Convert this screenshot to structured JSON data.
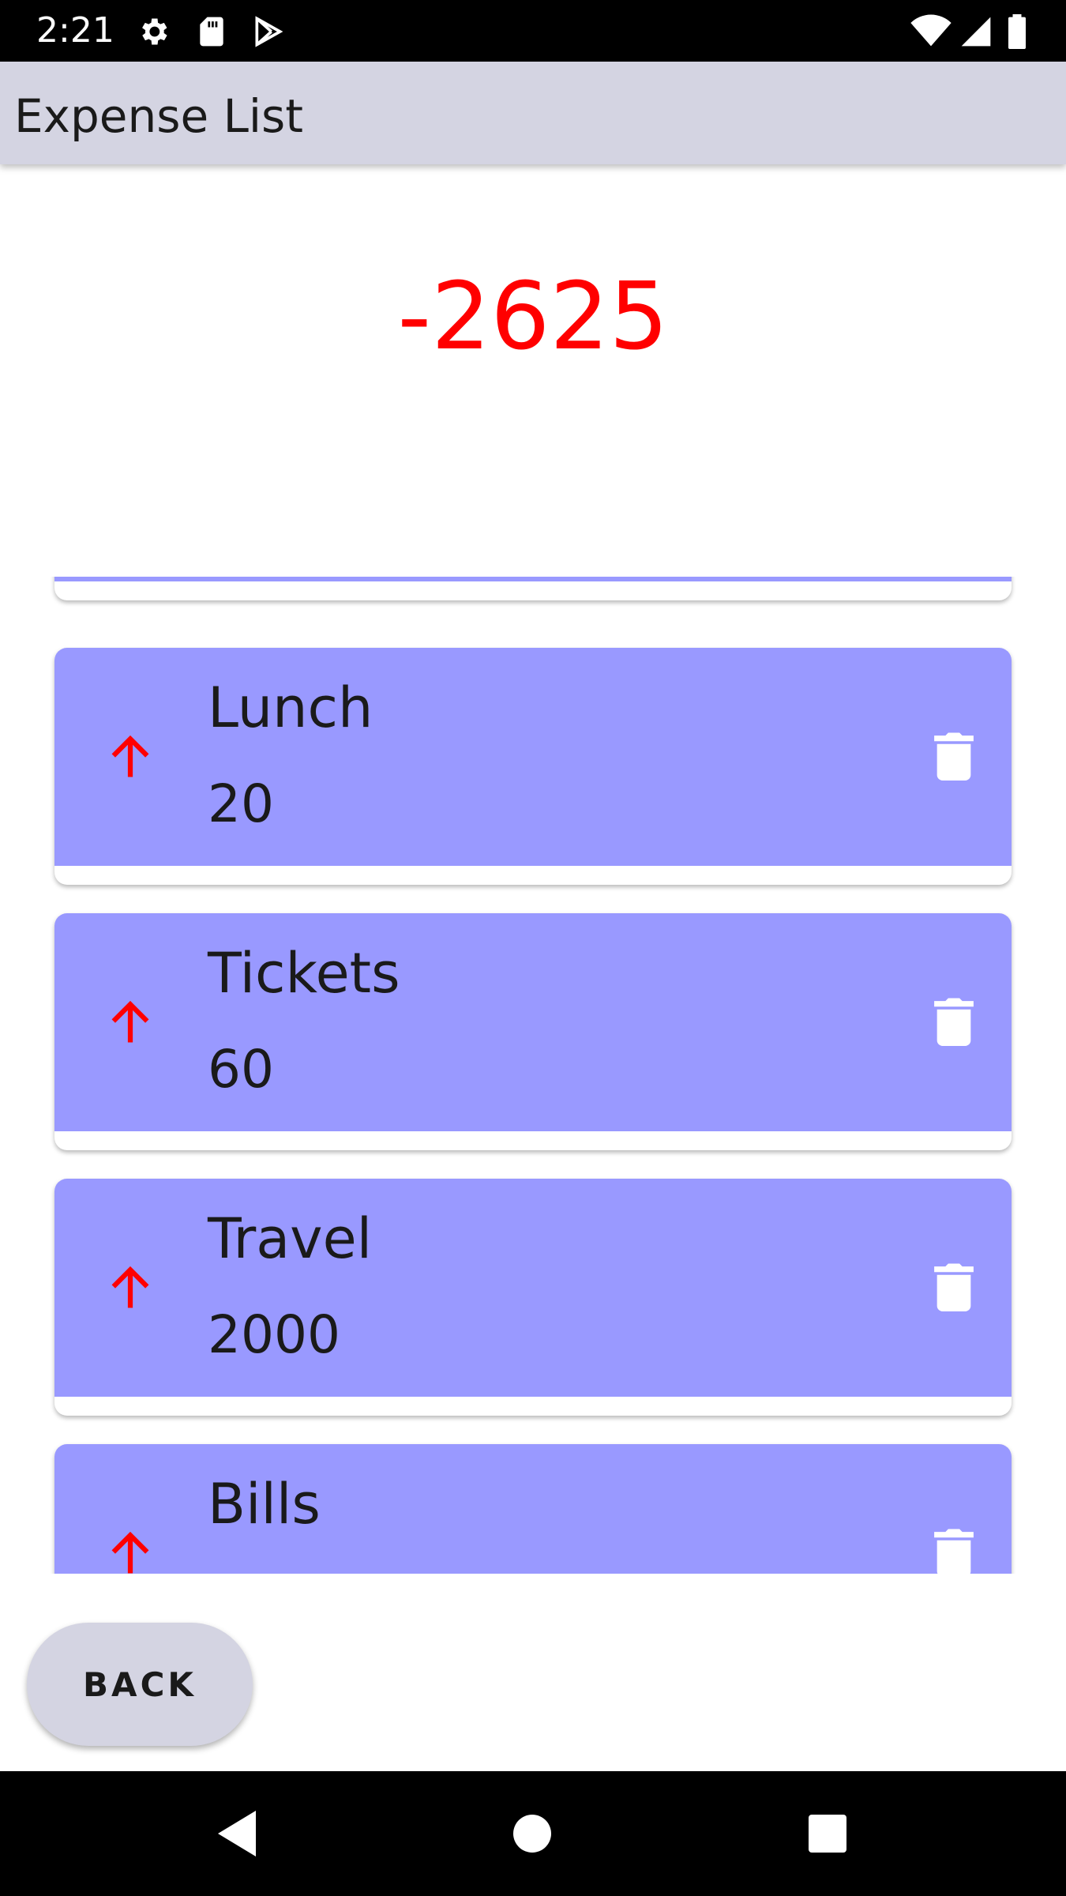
{
  "status_bar": {
    "time": "2:21",
    "icons": [
      "gear-icon",
      "sd-card-icon",
      "play-store-icon",
      "wifi-icon",
      "signal-icon",
      "battery-icon"
    ]
  },
  "app_bar": {
    "title": "Expense List",
    "background": "#d4d4e2"
  },
  "summary": {
    "total": "-2625",
    "color": "#ff0000"
  },
  "expenses": {
    "card_color": "#9999ff",
    "items": [
      {
        "name": "",
        "amount": ""
      },
      {
        "name": "Lunch",
        "amount": "20"
      },
      {
        "name": "Tickets",
        "amount": "60"
      },
      {
        "name": "Travel",
        "amount": "2000"
      },
      {
        "name": "Bills",
        "amount": ""
      }
    ]
  },
  "actions": {
    "back_label": "BACK"
  },
  "nav_bar": {
    "icons": [
      "back-triangle-icon",
      "home-circle-icon",
      "recents-square-icon"
    ]
  }
}
